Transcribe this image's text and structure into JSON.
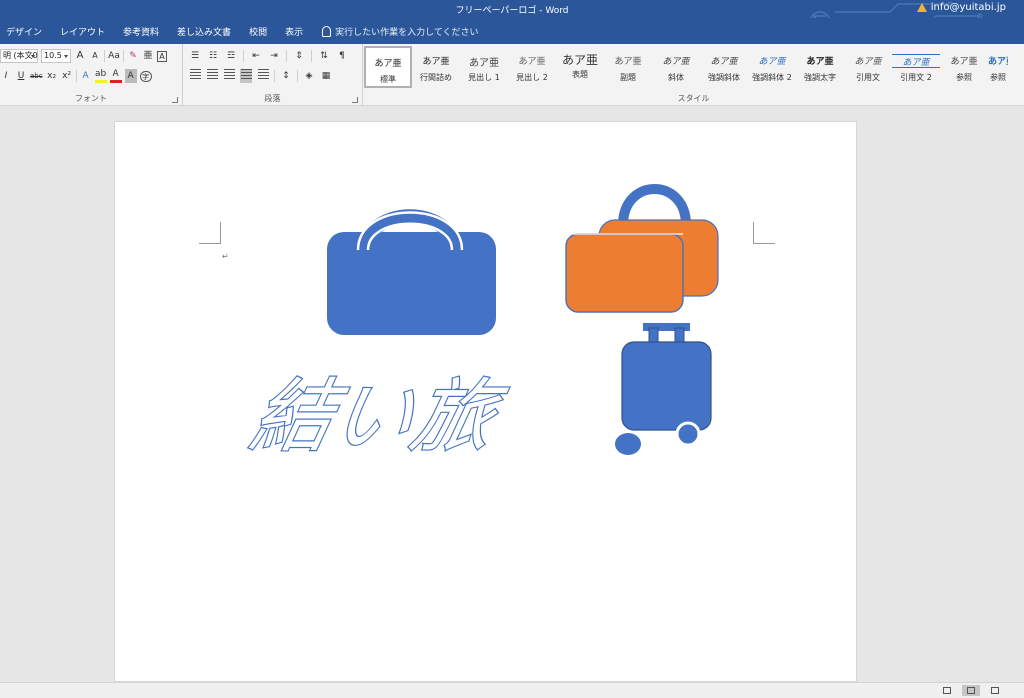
{
  "window": {
    "title": "フリーペーパーロゴ - Word",
    "account": "info@yuitabi.jp"
  },
  "tabs": [
    "デザイン",
    "レイアウト",
    "参考資料",
    "差し込み文書",
    "校閲",
    "表示"
  ],
  "tell_me": {
    "text": "実行したい作業を入力してください"
  },
  "font_group": {
    "label": "フォント",
    "font_name": "明 (本文0",
    "font_size": "10.5",
    "grow": "A",
    "shrink": "A",
    "case": "Aa",
    "phonetic": "亜",
    "enclose": "A",
    "italic": "I",
    "underline": "U",
    "strike": "abc",
    "subscript": "x₂",
    "superscript": "x²",
    "effects": "A",
    "highlight": "ab",
    "font_color": "A",
    "shade": "A",
    "circle": "字"
  },
  "paragraph_group": {
    "label": "段落"
  },
  "styles_group": {
    "label": "スタイル",
    "sample_text": "あア亜",
    "items": [
      {
        "name": "標準",
        "sample": "あア亜"
      },
      {
        "name": "行間詰め",
        "sample": "あア亜"
      },
      {
        "name": "見出し 1",
        "sample": "あア亜"
      },
      {
        "name": "見出し 2",
        "sample": "あア亜"
      },
      {
        "name": "表題",
        "sample": "あア亜"
      },
      {
        "name": "副題",
        "sample": "あア亜"
      },
      {
        "name": "斜体",
        "sample": "あア亜"
      },
      {
        "name": "強調斜体",
        "sample": "あア亜"
      },
      {
        "name": "強調斜体 2",
        "sample": "あア亜"
      },
      {
        "name": "強調太字",
        "sample": "あア亜"
      },
      {
        "name": "引用文",
        "sample": "あア亜"
      },
      {
        "name": "引用文 2",
        "sample": "あア亜"
      },
      {
        "name": "参照",
        "sample": "あア亜"
      },
      {
        "name": "参照",
        "sample": "あア亜"
      }
    ]
  },
  "document": {
    "logo_text": "結い旅",
    "paragraph_mark": "↵"
  },
  "colors": {
    "accent_blue": "#4472c4",
    "accent_orange": "#ed7d31",
    "ribbon_blue": "#2b579a"
  }
}
